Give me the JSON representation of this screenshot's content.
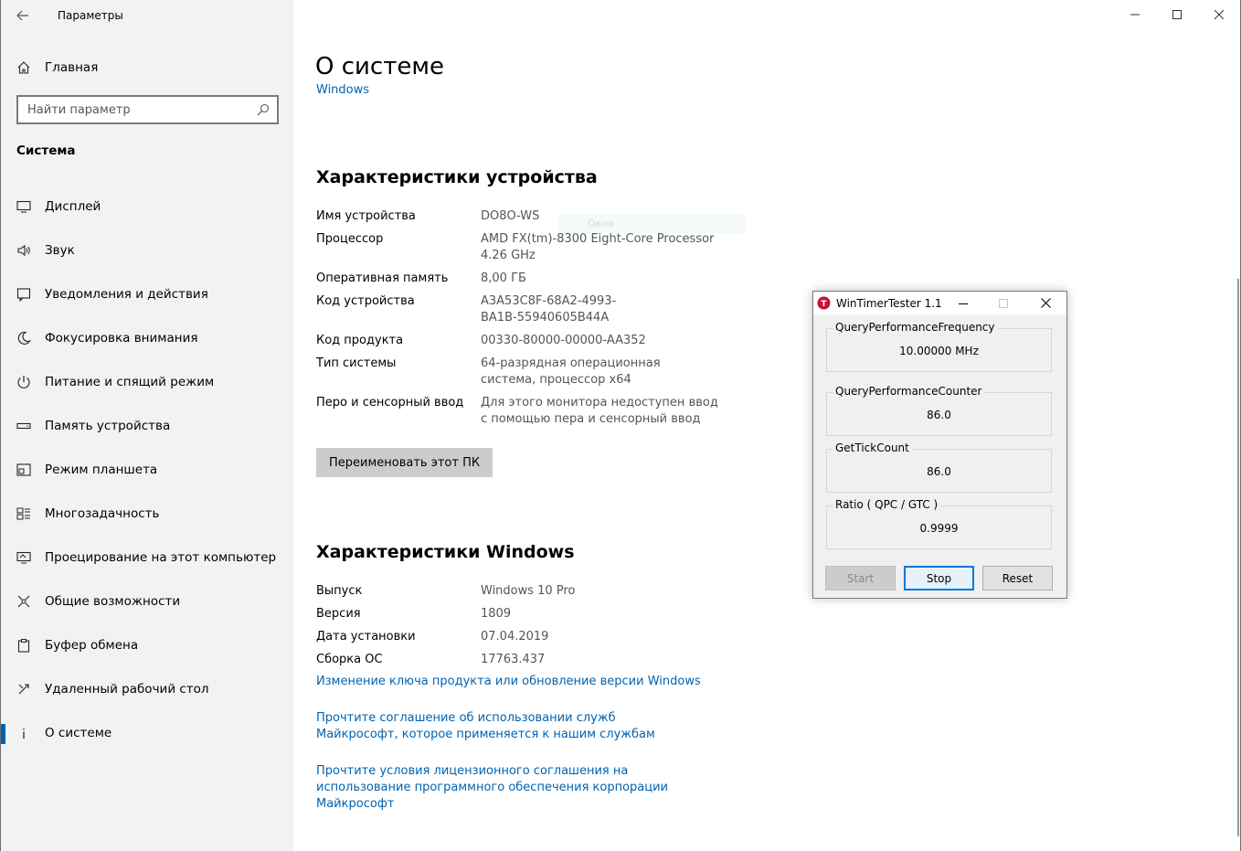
{
  "window": {
    "app_title": "Параметры",
    "back_icon": "arrow-left-icon",
    "controls": [
      "minimize",
      "maximize",
      "close"
    ]
  },
  "sidebar": {
    "home_label": "Главная",
    "search_placeholder": "Найти параметр",
    "section_title": "Система",
    "items": [
      {
        "label": "Дисплей",
        "icon": "display-icon"
      },
      {
        "label": "Звук",
        "icon": "speaker-icon"
      },
      {
        "label": "Уведомления и действия",
        "icon": "notification-icon"
      },
      {
        "label": "Фокусировка внимания",
        "icon": "moon-icon"
      },
      {
        "label": "Питание и спящий режим",
        "icon": "power-icon"
      },
      {
        "label": "Память устройства",
        "icon": "storage-icon"
      },
      {
        "label": "Режим планшета",
        "icon": "tablet-icon"
      },
      {
        "label": "Многозадачность",
        "icon": "multitask-icon"
      },
      {
        "label": "Проецирование на этот компьютер",
        "icon": "project-icon"
      },
      {
        "label": "Общие возможности",
        "icon": "shared-icon"
      },
      {
        "label": "Буфер обмена",
        "icon": "clipboard-icon"
      },
      {
        "label": "Удаленный рабочий стол",
        "icon": "remote-icon"
      },
      {
        "label": "О системе",
        "icon": "info-icon",
        "active": true
      }
    ]
  },
  "main": {
    "page_title": "О системе",
    "cut_link": "Windows",
    "ghost_text": "Окно",
    "device_specs": {
      "title": "Характеристики устройства",
      "rows": [
        {
          "key": "Имя устройства",
          "value": "DO8O-WS"
        },
        {
          "key": "Процессор",
          "value": "AMD FX(tm)-8300 Eight-Core Processor 4.26 GHz"
        },
        {
          "key": "Оперативная память",
          "value": "8,00 ГБ"
        },
        {
          "key": "Код устройства",
          "value": "A3A53C8F-68A2-4993-BA1B-55940605B44A"
        },
        {
          "key": "Код продукта",
          "value": "00330-80000-00000-AA352"
        },
        {
          "key": "Тип системы",
          "value": "64-разрядная операционная система, процессор x64"
        },
        {
          "key": "Перо и сенсорный ввод",
          "value": "Для этого монитора недоступен ввод с помощью пера и сенсорный ввод"
        }
      ],
      "rename_button": "Переименовать этот ПК"
    },
    "windows_specs": {
      "title": "Характеристики Windows",
      "rows": [
        {
          "key": "Выпуск",
          "value": "Windows 10 Pro"
        },
        {
          "key": "Версия",
          "value": "1809"
        },
        {
          "key": "Дата установки",
          "value": "07.04.2019"
        },
        {
          "key": "Сборка ОС",
          "value": "17763.437"
        }
      ]
    },
    "links": [
      "Изменение ключа продукта или обновление версии Windows",
      "Прочтите соглашение об использовании служб Майкрософт, которое применяется к нашим службам",
      "Прочтите условия лицензионного соглашения на использование программного обеспечения корпорации Майкрософт"
    ]
  },
  "timer_tester": {
    "title": "WinTimerTester 1.1",
    "logo_letter": "T",
    "groups": [
      {
        "label": "QueryPerformanceFrequency",
        "value": "10.00000 MHz"
      },
      {
        "label": "QueryPerformanceCounter",
        "value": "86.0"
      },
      {
        "label": "GetTickCount",
        "value": "86.0"
      },
      {
        "label": "Ratio  ( QPC / GTC )",
        "value": "0.9999"
      }
    ],
    "buttons": {
      "start": "Start",
      "stop": "Stop",
      "reset": "Reset"
    },
    "accent": "#c8102e"
  }
}
